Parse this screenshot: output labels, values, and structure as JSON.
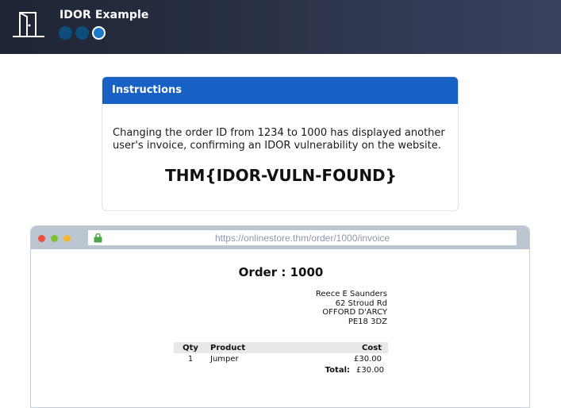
{
  "header": {
    "title": "IDOR Example",
    "icon": "door-icon",
    "steps": [
      {
        "state": "complete"
      },
      {
        "state": "complete"
      },
      {
        "state": "active"
      }
    ]
  },
  "instructions": {
    "heading": "Instructions",
    "text": "Changing the order ID from 1234 to 1000 has displayed another user's invoice, confirming an IDOR vulnerability on the website.",
    "flag": "THM{IDOR-VULN-FOUND}"
  },
  "browser": {
    "url": "https://onlinestore.thm/order/1000/invoice",
    "lock_icon": "lock-icon"
  },
  "invoice": {
    "title": "Order : 1000",
    "address": [
      "Reece E Saunders",
      "62 Stroud Rd",
      "OFFORD D'ARCY",
      "PE18 3DZ"
    ],
    "columns": {
      "qty": "Qty",
      "product": "Product",
      "cost": "Cost"
    },
    "items": [
      {
        "qty": "1",
        "product": "Jumper",
        "cost": "£30.00"
      }
    ],
    "total_label": "Total:",
    "total_value": "£30.00"
  },
  "colors": {
    "accent": "#1760c4",
    "topbar": "#2a3146"
  }
}
